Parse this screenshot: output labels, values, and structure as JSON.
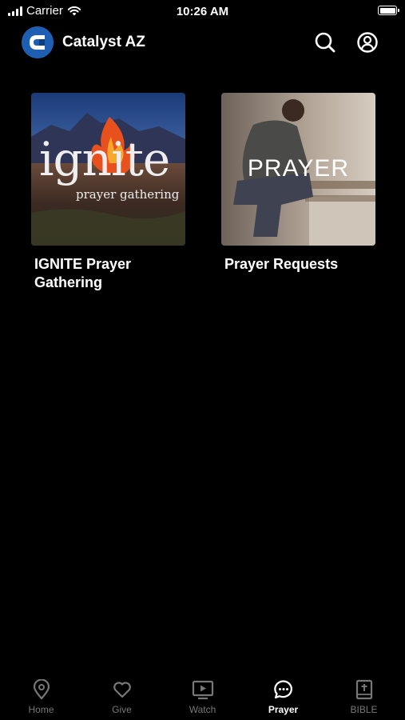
{
  "status": {
    "carrier": "Carrier",
    "time": "10:26 AM"
  },
  "header": {
    "title": "Catalyst AZ",
    "logo_icon": "catalyst-logo",
    "search_icon": "search-icon",
    "profile_icon": "account-icon"
  },
  "tiles": [
    {
      "title": "IGNITE Prayer Gathering",
      "image_word": "ignite",
      "image_sub": "prayer gathering"
    },
    {
      "title": "Prayer Requests",
      "image_word": "PRAYER"
    }
  ],
  "tabs": [
    {
      "label": "Home",
      "icon": "location-pin-icon"
    },
    {
      "label": "Give",
      "icon": "heart-icon"
    },
    {
      "label": "Watch",
      "icon": "play-screen-icon"
    },
    {
      "label": "Prayer",
      "icon": "chat-bubble-icon"
    },
    {
      "label": "BIBLE",
      "icon": "bible-icon"
    }
  ],
  "active_tab": "Prayer",
  "colors": {
    "background": "#000000",
    "accent": "#1f5fb3",
    "inactive_tab": "#777777"
  }
}
